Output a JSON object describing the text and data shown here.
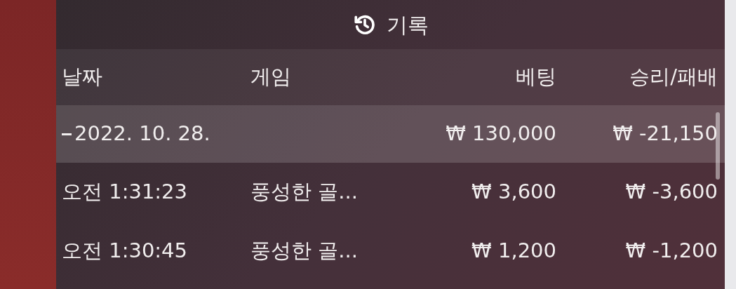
{
  "title": "기록",
  "table": {
    "columns": [
      "날짜",
      "게임",
      "베팅",
      "승리/패배"
    ],
    "groups": [
      {
        "date": "2022. 10. 28.",
        "expanded": true,
        "bet": "₩ 130,000",
        "result": "₩ -21,150",
        "rows": [
          {
            "time": "오전 1:31:23",
            "game": "풍성한 골...",
            "bet": "₩ 3,600",
            "result": "₩ -3,600"
          },
          {
            "time": "오전 1:30:45",
            "game": "풍성한 골...",
            "bet": "₩ 1,200",
            "result": "₩ -1,200"
          }
        ]
      }
    ]
  }
}
